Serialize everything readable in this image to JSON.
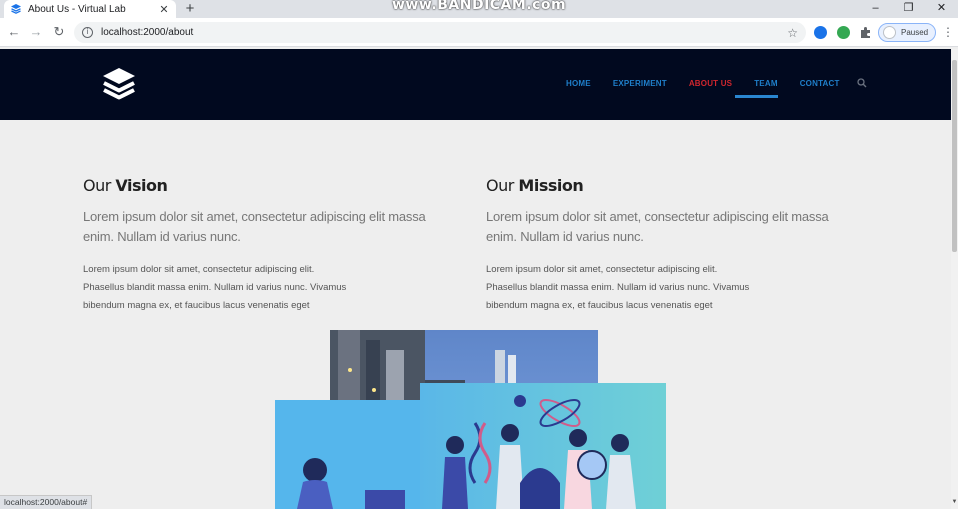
{
  "browser": {
    "tab_title": "About Us - Virtual Lab",
    "url": "localhost:2000/about",
    "profile_status": "Paused",
    "status_url": "localhost:2000/about#",
    "watermark": "www.BANDICAM.com"
  },
  "nav": {
    "items": [
      {
        "label": "HOME"
      },
      {
        "label": "EXPERIMENT"
      },
      {
        "label": "ABOUT US"
      },
      {
        "label": "TEAM"
      },
      {
        "label": "CONTACT"
      }
    ],
    "active_item": "ABOUT US",
    "colors": {
      "link": "#1f7fca",
      "active": "#d0262e",
      "header_bg": "#01091f"
    }
  },
  "vision": {
    "title_light": "Our",
    "title_bold": "Vision",
    "lead": "Lorem ipsum dolor sit amet, consectetur adipiscing elit massa enim. Nullam id varius nunc.",
    "body_lines": [
      "Lorem ipsum dolor sit amet, consectetur adipiscing elit.",
      "Phasellus blandit massa enim. Nullam id varius nunc. Vivamus",
      "bibendum magna ex, et faucibus lacus venenatis eget"
    ]
  },
  "mission": {
    "title_light": "Our",
    "title_bold": "Mission",
    "lead": "Lorem ipsum dolor sit amet, consectetur adipiscing elit massa enim. Nullam id varius nunc.",
    "body_lines": [
      "Lorem ipsum dolor sit amet, consectetur adipiscing elit.",
      "Phasellus blandit massa enim. Nullam id varius nunc. Vivamus",
      "bibendum magna ex, et faucibus lacus venenatis eget"
    ]
  },
  "icons": [
    "layers-logo-icon",
    "search-icon",
    "back-icon",
    "forward-icon",
    "reload-icon",
    "info-icon",
    "star-icon",
    "extensions-icon",
    "menu-icon"
  ]
}
